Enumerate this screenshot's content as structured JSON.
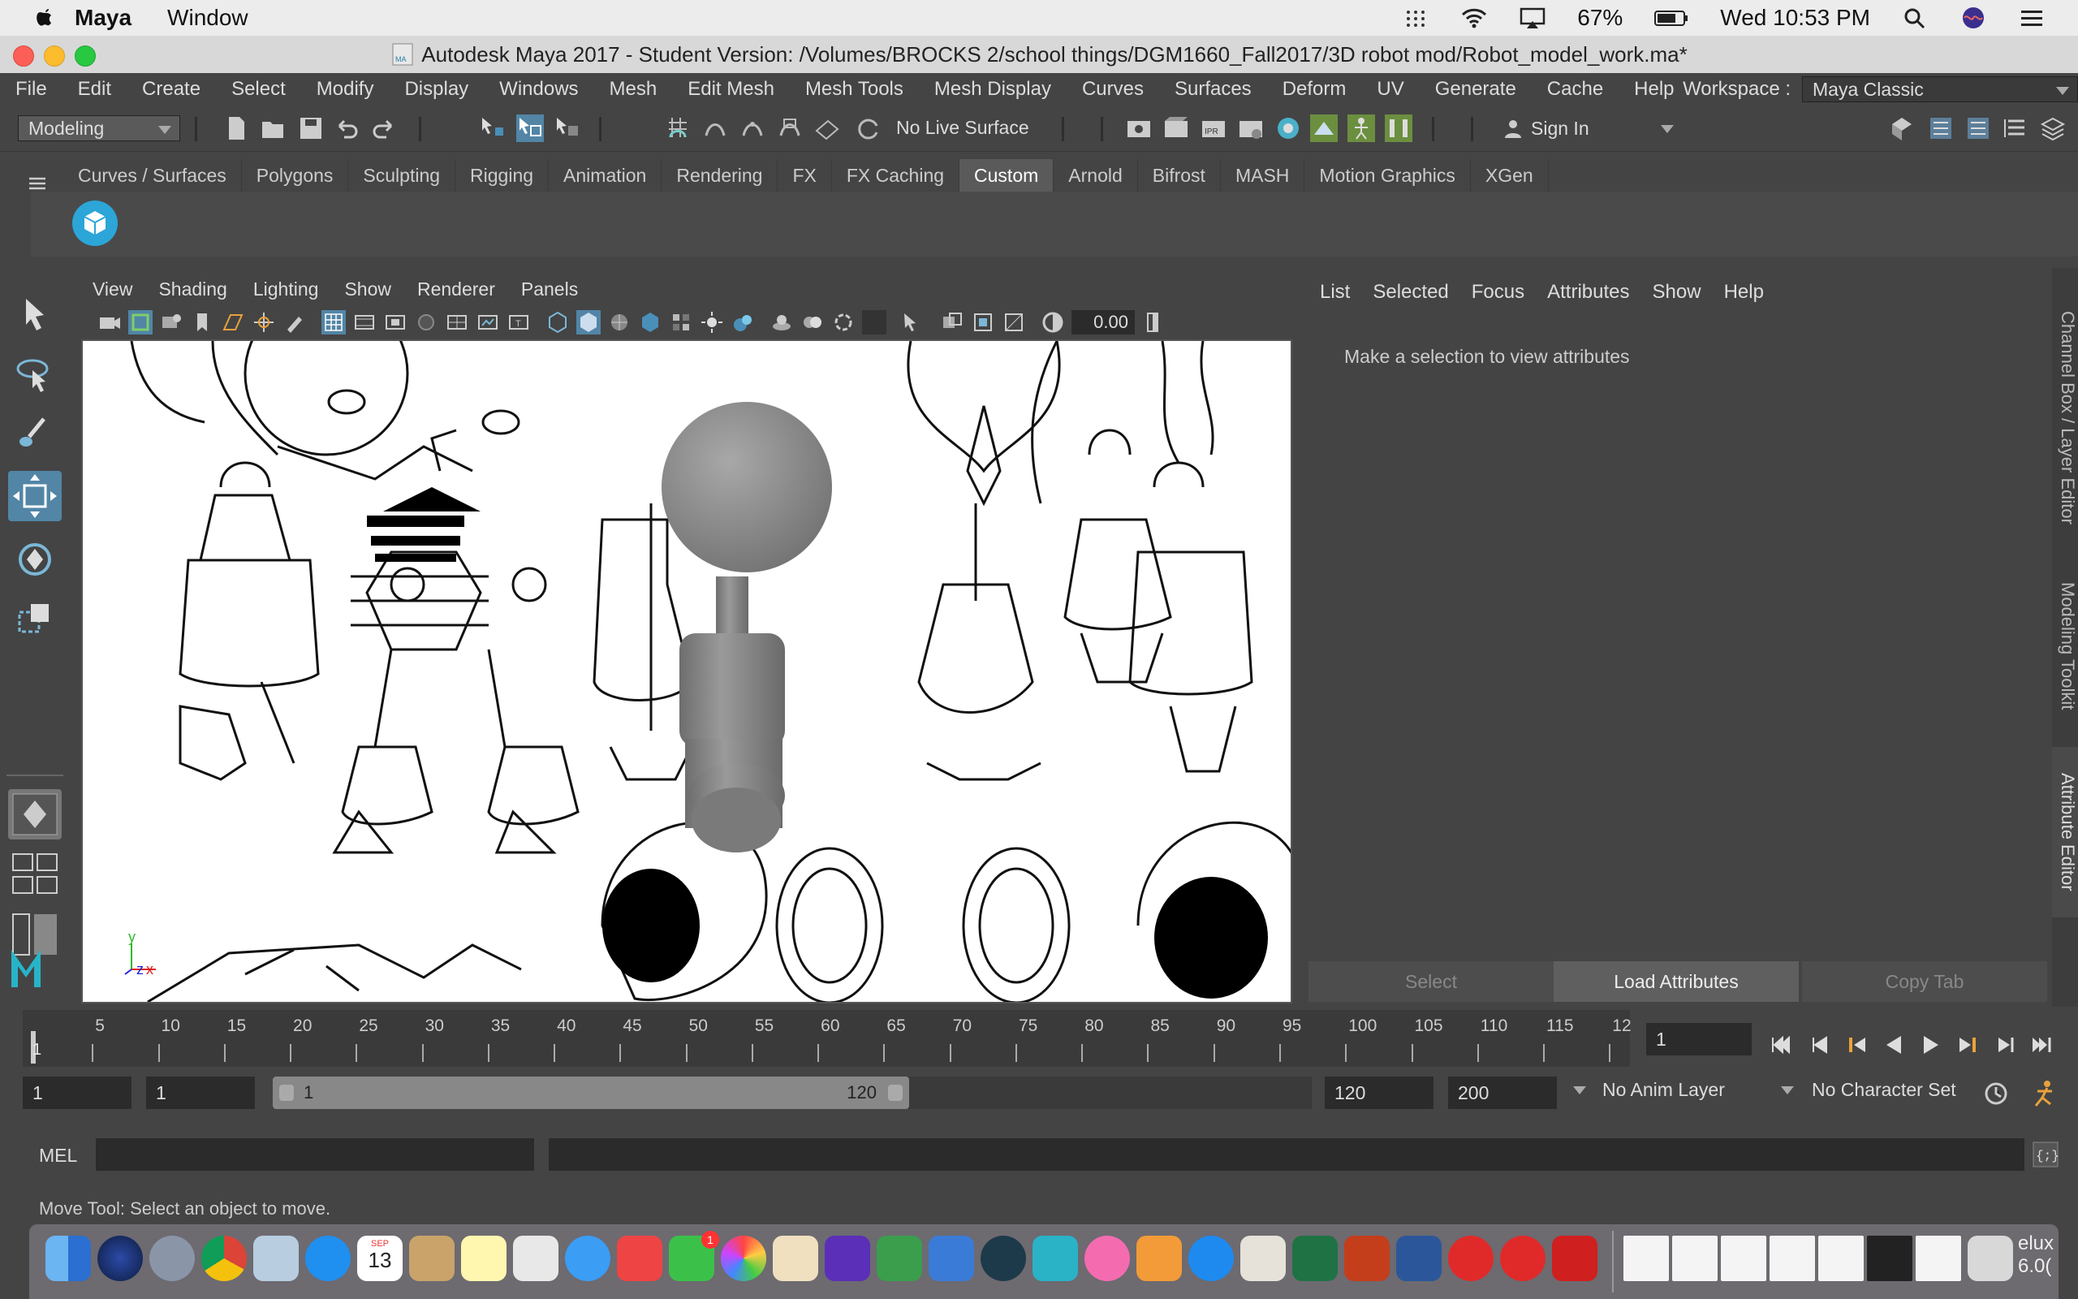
{
  "mac": {
    "app_name": "Maya",
    "menu": [
      "Window"
    ],
    "battery": "67%",
    "clock": "Wed 10:53 PM"
  },
  "window": {
    "title": "Autodesk Maya 2017 - Student Version: /Volumes/BROCKS 2/school things/DGM1660_Fall2017/3D robot mod/Robot_model_work.ma*"
  },
  "menubar": {
    "items": [
      "File",
      "Edit",
      "Create",
      "Select",
      "Modify",
      "Display",
      "Windows",
      "Mesh",
      "Edit Mesh",
      "Mesh Tools",
      "Mesh Display",
      "Curves",
      "Surfaces",
      "Deform",
      "UV",
      "Generate",
      "Cache",
      "Help"
    ],
    "workspace_label": "Workspace :",
    "workspace_value": "Maya Classic"
  },
  "statusline": {
    "menu_set": "Modeling",
    "live_surface": "No Live Surface",
    "sign_in": "Sign In"
  },
  "shelf": {
    "tabs": [
      "Curves / Surfaces",
      "Polygons",
      "Sculpting",
      "Rigging",
      "Animation",
      "Rendering",
      "FX",
      "FX Caching",
      "Custom",
      "Arnold",
      "Bifrost",
      "MASH",
      "Motion Graphics",
      "XGen"
    ],
    "active": "Custom"
  },
  "viewport": {
    "menu": [
      "View",
      "Shading",
      "Lighting",
      "Show",
      "Renderer",
      "Panels"
    ],
    "camera_value": "0.00",
    "axis_y": "y",
    "axis_z": "z",
    "axis_x": "x"
  },
  "attribute_editor": {
    "menu": [
      "List",
      "Selected",
      "Focus",
      "Attributes",
      "Show",
      "Help"
    ],
    "message": "Make a selection to view attributes",
    "buttons": [
      "Select",
      "Load Attributes",
      "Copy Tab"
    ]
  },
  "side_tabs": [
    "Channel Box / Layer Editor",
    "Modeling Toolkit",
    "Attribute Editor"
  ],
  "timeslider": {
    "ticks": [
      "5",
      "10",
      "15",
      "20",
      "25",
      "30",
      "35",
      "40",
      "45",
      "50",
      "55",
      "60",
      "65",
      "70",
      "75",
      "80",
      "85",
      "90",
      "95",
      "100",
      "105",
      "110",
      "115",
      "12"
    ],
    "current_marker": "1",
    "current_frame": "1"
  },
  "range": {
    "start": "1",
    "playback_start": "1",
    "slider_start": "1",
    "slider_end": "120",
    "playback_end": "120",
    "end": "200",
    "anim_layer": "No Anim Layer",
    "character_set": "No Character Set"
  },
  "command": {
    "label": "MEL"
  },
  "help_line": "Move Tool: Select an object to move.",
  "dock": {
    "calendar_month": "SEP",
    "calendar_day": "13",
    "facetime_badge": "1",
    "edge_text": "elux",
    "edge_text2": "6.0("
  }
}
